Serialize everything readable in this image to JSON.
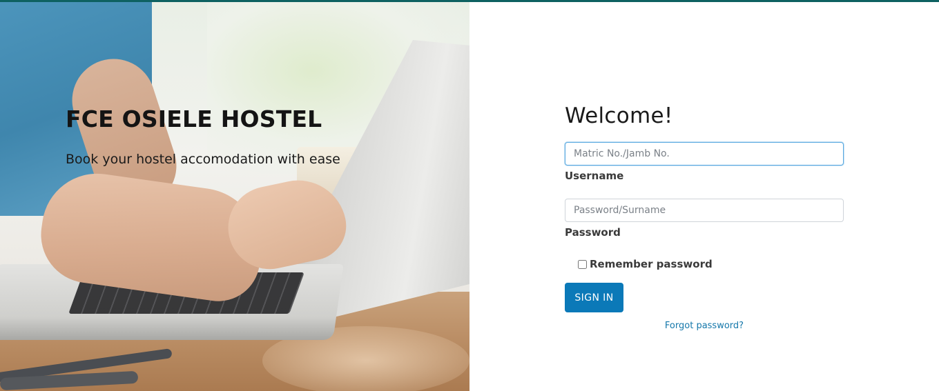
{
  "hero": {
    "title": "FCE OSIELE HOSTEL",
    "subtitle": "Book your hostel accomodation with ease"
  },
  "login": {
    "heading": "Welcome!",
    "username": {
      "placeholder": "Matric No./Jamb No.",
      "value": "",
      "label": "Username"
    },
    "password": {
      "placeholder": "Password/Surname",
      "value": "",
      "label": "Password"
    },
    "remember": {
      "label": "Remember password",
      "checked": false
    },
    "submit_label": "SIGN IN",
    "forgot_label": "Forgot password?"
  },
  "colors": {
    "accent_bar": "#0e6161",
    "button": "#0b79b8",
    "link": "#1477aa"
  }
}
